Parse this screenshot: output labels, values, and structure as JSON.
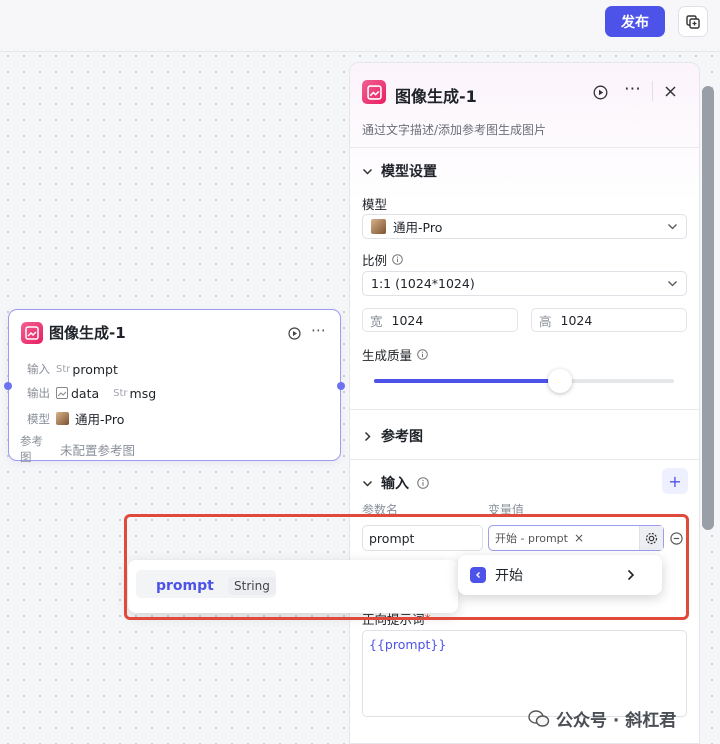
{
  "toolbar": {
    "publish_label": "发布"
  },
  "node": {
    "title": "图像生成-1",
    "input_label": "输入",
    "input_type": "Str",
    "input_value": "prompt",
    "output_label": "输出",
    "output_data": "data",
    "output_type": "Str",
    "output_msg": "msg",
    "model_label": "模型",
    "model_value": "通用-Pro",
    "ref_label": "参考图",
    "ref_value": "未配置参考图"
  },
  "panel": {
    "title": "图像生成-1",
    "description": "通过文字描述/添加参考图生成图片",
    "model_section": "模型设置",
    "model_label": "模型",
    "model_value": "通用-Pro",
    "ratio_label": "比例",
    "ratio_value": "1:1 (1024*1024)",
    "width_label": "宽",
    "width_value": "1024",
    "height_label": "高",
    "height_value": "1024",
    "quality_label": "生成质量",
    "quality_level": 0.62,
    "ref_section": "参考图",
    "input_section": "输入",
    "col_param": "参数名",
    "col_var": "变量值",
    "param_value": "prompt",
    "var_value": "开始 - prompt",
    "prompt_label": "正向提示词",
    "prompt_required": "*",
    "prompt_value": "{{prompt}}"
  },
  "popup": {
    "var_name": "prompt",
    "var_type": "String",
    "source_label": "开始"
  },
  "watermark": {
    "text": "公众号 · 斜杠君"
  },
  "colors": {
    "accent": "#4d53e8",
    "highlight": "#e04a3c",
    "node_icon": "#e91e63"
  }
}
